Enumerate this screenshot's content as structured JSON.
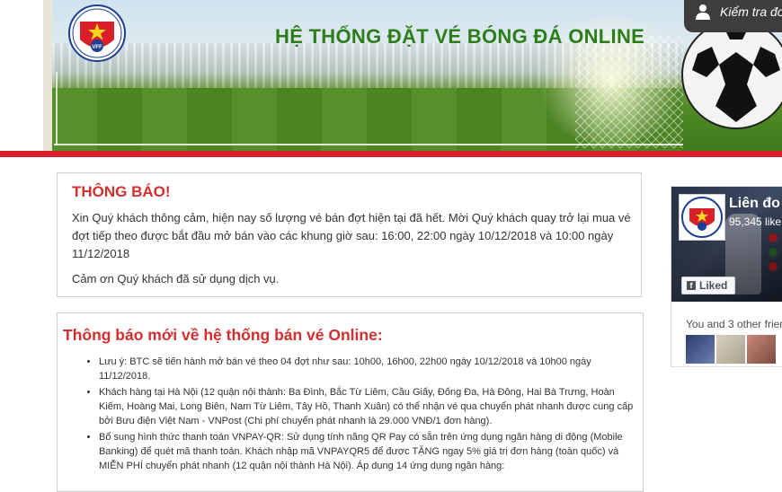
{
  "header": {
    "title": "HỆ THỐNG ĐẶT VÉ BÓNG ĐÁ ONLINE",
    "check_label": "Kiểm tra đơ",
    "logo_icon": "vff-logo",
    "colors": {
      "title": "#2e7d1c",
      "accent_bar": "#d92028"
    }
  },
  "notice": {
    "title": "THÔNG BÁO!",
    "body": "Xin Quý khách thông cảm, hiện nay số lượng vé bán đợt hiện tại đã hết. Mời Quý khách quay trở lại mua vé đợt tiếp theo được bắt đầu mở bán vào các khung giờ sau: 16:00, 22:00 ngày 10/12/2018 và 10:00 ngày 11/12/2018",
    "thanks": "Cảm ơn Quý khách đã sử dụng dịch vụ."
  },
  "news": {
    "title": "Thông báo mới về hệ thống bán vé Online:",
    "items": [
      "Lưu ý: BTC sẽ tiến hành mở bán vé theo 04 đợt như sau: 10h00, 16h00, 22h00 ngày 10/12/2018 và 10h00 ngày 11/12/2018.",
      "Khách hàng tại Hà Nội (12 quận nội thành: Ba Đình, Bắc Từ Liêm, Cầu Giấy, Đống Đa, Hà Đông, Hai Bà Trưng, Hoàn Kiếm, Hoàng Mai, Long Biên, Nam Từ Liêm, Tây Hồ, Thanh Xuân) có thể nhận vé qua chuyển phát nhanh được cung cấp bởi Bưu điện Việt Nam - VNPost (Chi phí chuyển phát nhanh là 29.000 VNĐ/1 đơn hàng).",
      "Bổ sung hình thức thanh toán VNPAY-QR: Sử dụng tính năng QR Pay có sẵn trên ứng dụng ngân hàng di động (Mobile Banking) để quét mã thanh toán. Khách nhập mã VNPAYQR5 để được TẶNG ngay 5% giá trị đơn hàng (toàn quốc) và MIỄN PHÍ chuyển phát nhanh (12 quận nội thành Hà Nội). Áp dụng 14 ứng dụng ngân hàng:"
    ]
  },
  "facebook": {
    "page_name": "Liên đo",
    "likes": "95,345 like",
    "liked_label": "Liked",
    "friends_text": "You and 3 other frien",
    "colors": {
      "cover": "#2d3b52"
    }
  }
}
